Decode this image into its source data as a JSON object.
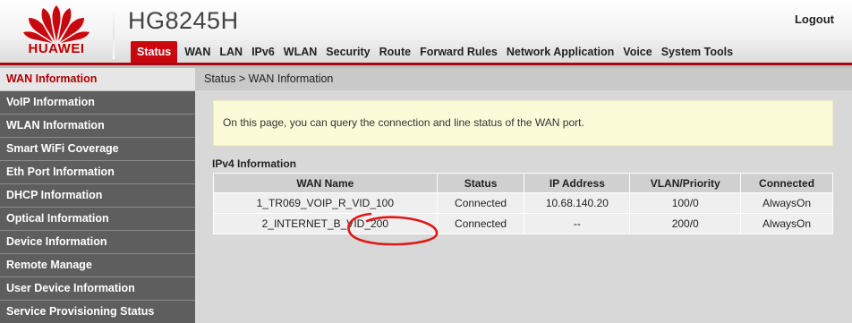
{
  "brand": {
    "logo_text": "HUAWEI",
    "device_model": "HG8245H",
    "logout_label": "Logout",
    "accent_color": "#c8070f"
  },
  "nav": {
    "items": [
      {
        "label": "Status",
        "active": true
      },
      {
        "label": "WAN"
      },
      {
        "label": "LAN"
      },
      {
        "label": "IPv6"
      },
      {
        "label": "WLAN"
      },
      {
        "label": "Security"
      },
      {
        "label": "Route"
      },
      {
        "label": "Forward Rules"
      },
      {
        "label": "Network Application"
      },
      {
        "label": "Voice"
      },
      {
        "label": "System Tools"
      }
    ]
  },
  "sidebar": {
    "items": [
      {
        "label": "WAN Information",
        "active": true
      },
      {
        "label": "VoIP Information"
      },
      {
        "label": "WLAN Information"
      },
      {
        "label": "Smart WiFi Coverage"
      },
      {
        "label": "Eth Port Information"
      },
      {
        "label": "DHCP Information"
      },
      {
        "label": "Optical Information"
      },
      {
        "label": "Device Information"
      },
      {
        "label": "Remote Manage"
      },
      {
        "label": "User Device Information"
      },
      {
        "label": "Service Provisioning Status"
      }
    ]
  },
  "main": {
    "breadcrumb": "Status > WAN Information",
    "info_text": "On this page, you can query the connection and line status of the WAN port.",
    "section_title": "IPv4 Information",
    "table": {
      "headers": [
        "WAN Name",
        "Status",
        "IP Address",
        "VLAN/Priority",
        "Connected"
      ],
      "rows": [
        [
          "1_TR069_VOIP_R_VID_100",
          "Connected",
          "10.68.140.20",
          "100/0",
          "AlwaysOn"
        ],
        [
          "2_INTERNET_B_VID_200",
          "Connected",
          "--",
          "200/0",
          "AlwaysOn"
        ]
      ]
    }
  },
  "annotation": {
    "color": "#e01818",
    "shape": "hand-drawn ellipse"
  }
}
